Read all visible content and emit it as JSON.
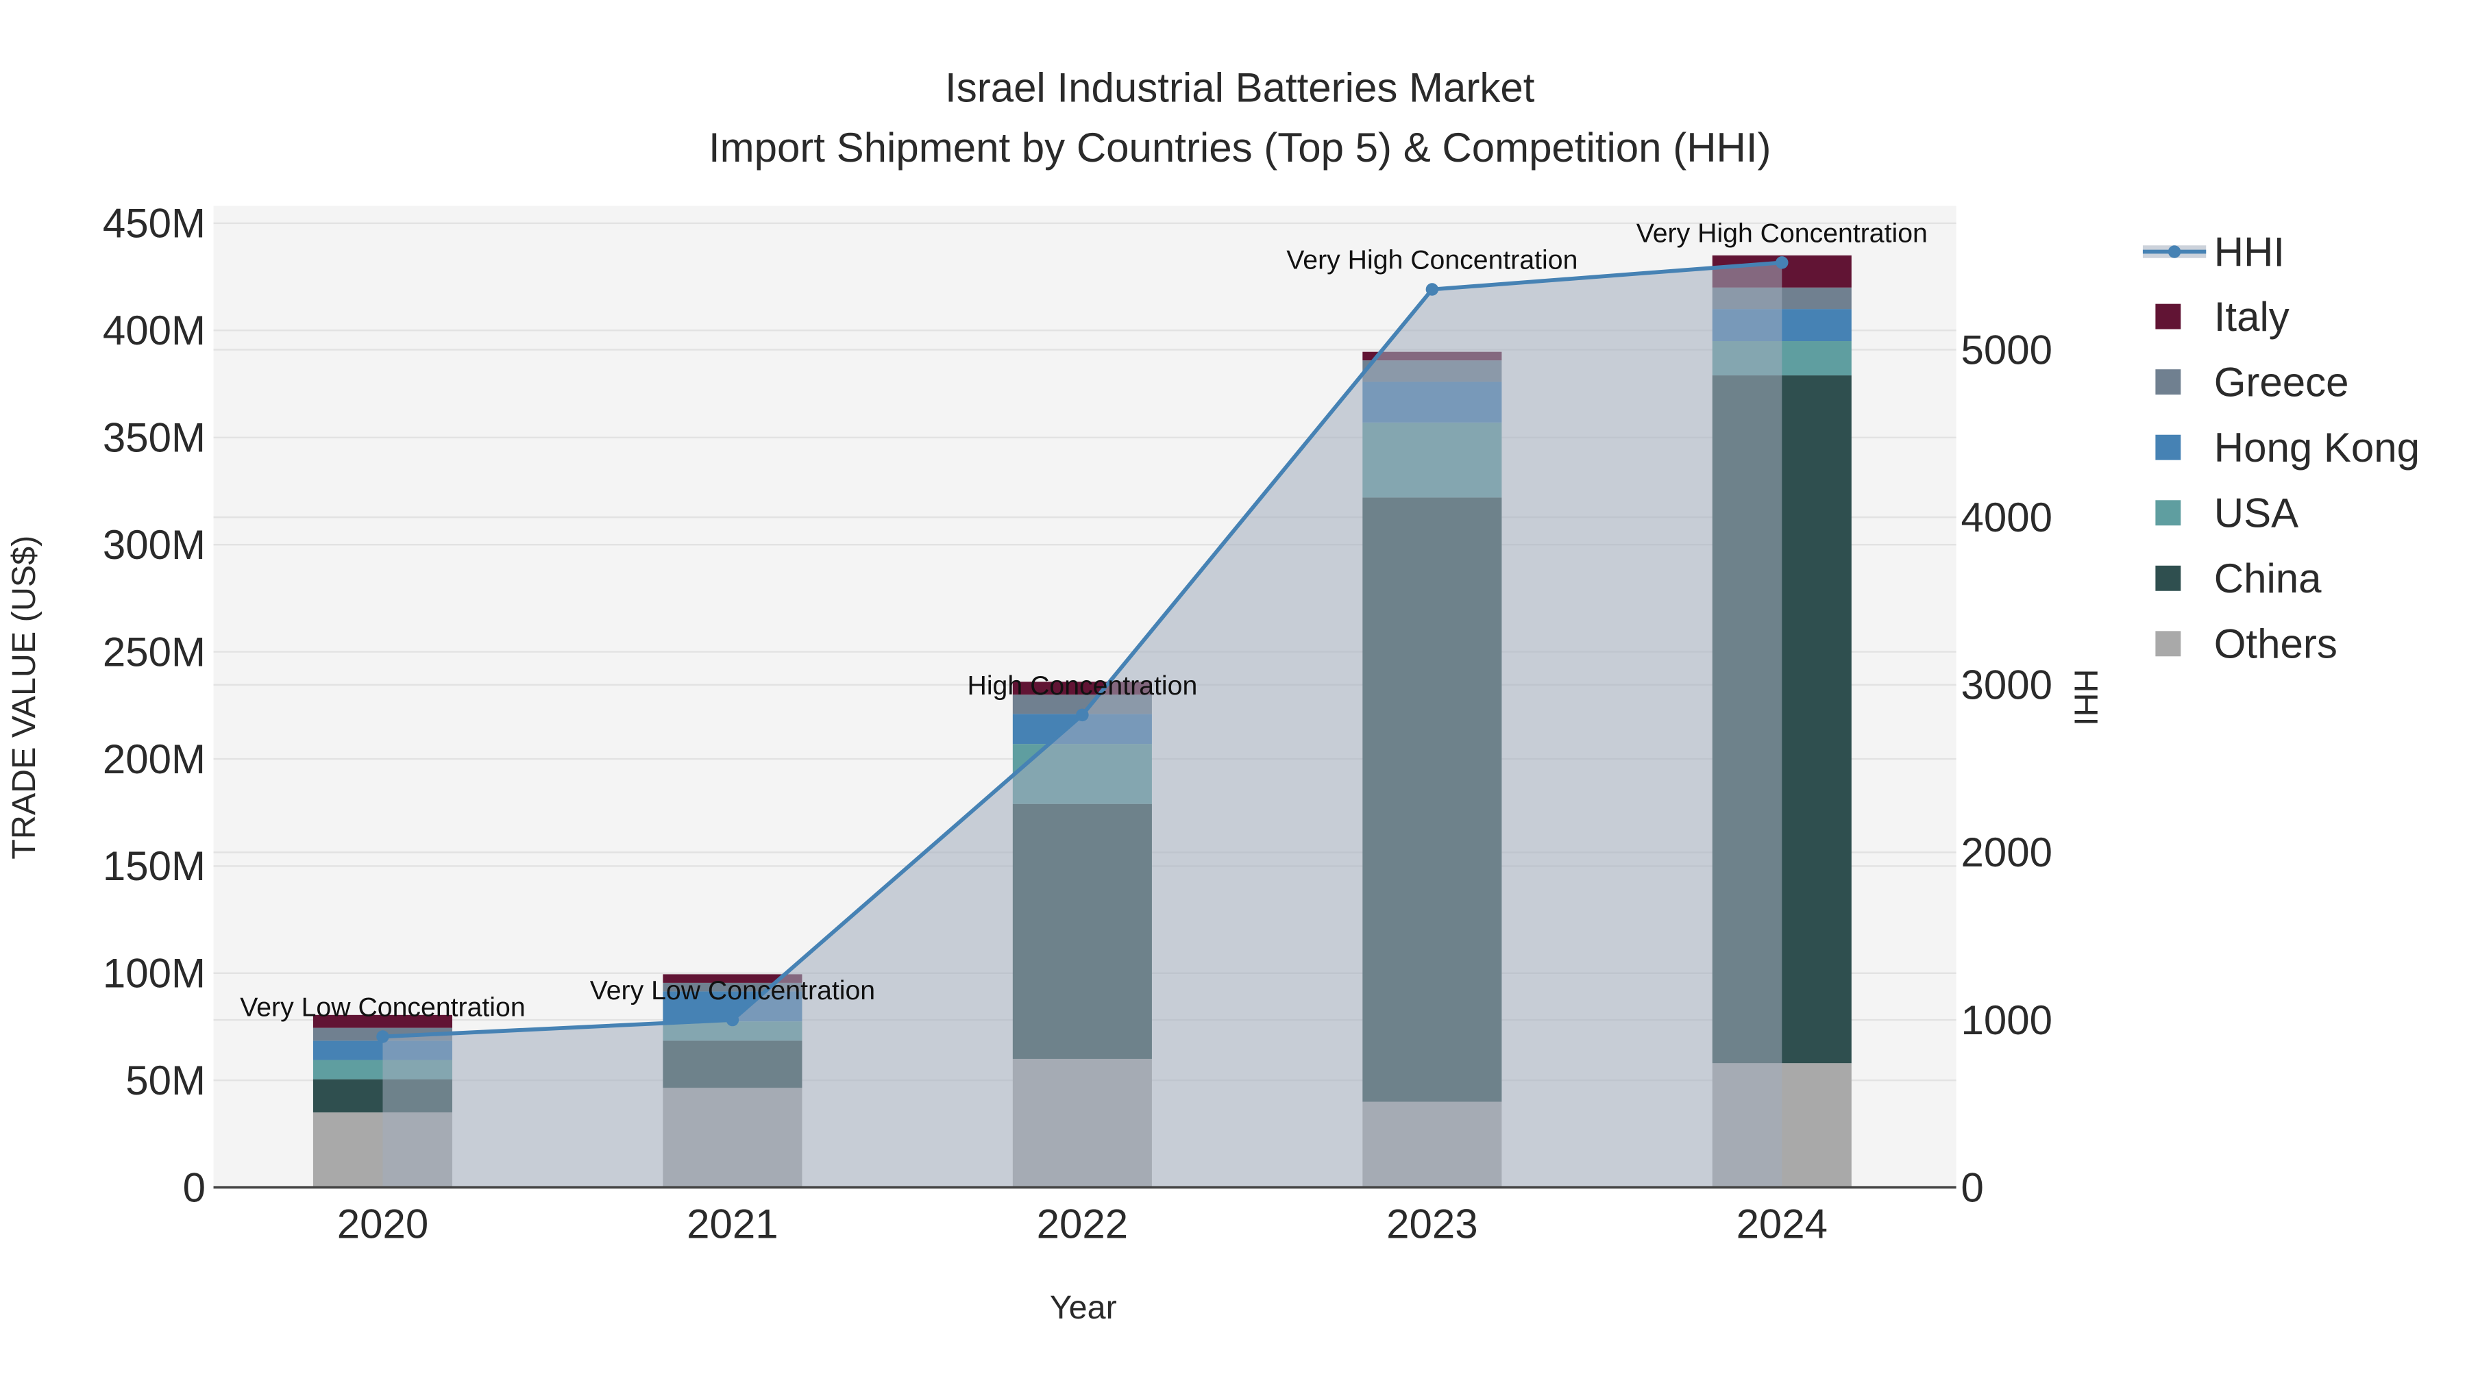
{
  "chart_data": {
    "type": "bar",
    "title": "Israel Industrial Batteries Market",
    "subtitle": "Import Shipment by Countries (Top 5) & Competition (HHI)",
    "xlabel": "Year",
    "ylabel": "TRADE VALUE (US$)",
    "y2label": "HHI",
    "categories": [
      "2020",
      "2021",
      "2022",
      "2023",
      "2024"
    ],
    "ylim": [
      0,
      450000000
    ],
    "y_ticks": [
      "0",
      "50M",
      "100M",
      "150M",
      "200M",
      "250M",
      "300M",
      "350M",
      "400M",
      "450M"
    ],
    "y2lim": [
      0,
      5800
    ],
    "y2_ticks": [
      "0",
      "1000",
      "2000",
      "3000",
      "4000",
      "5000"
    ],
    "stacked": true,
    "grid": true,
    "legend_position": "right",
    "series": [
      {
        "name": "Others",
        "color": "#a9a9a9",
        "values": [
          35000000,
          46500000,
          60000000,
          40000000,
          58000000
        ]
      },
      {
        "name": "China",
        "color": "#2f4f4f",
        "values": [
          15500000,
          22000000,
          119000000,
          282000000,
          321000000
        ]
      },
      {
        "name": "USA",
        "color": "#5f9ea0",
        "values": [
          9000000,
          9000000,
          28000000,
          35000000,
          16000000
        ]
      },
      {
        "name": "Hong Kong",
        "color": "#4682b4",
        "values": [
          9000000,
          14000000,
          14000000,
          19000000,
          15000000
        ]
      },
      {
        "name": "Greece",
        "color": "#708090",
        "values": [
          6000000,
          4000000,
          9000000,
          10000000,
          10000000
        ]
      },
      {
        "name": "Italy",
        "color": "#611434",
        "values": [
          6000000,
          4000000,
          6000000,
          4000000,
          15000000
        ]
      }
    ],
    "hhi": {
      "name": "HHI",
      "color": "#4682b4",
      "values": [
        900,
        1000,
        2820,
        5360,
        5520
      ],
      "labels": [
        "Very Low Concentration",
        "Very Low Concentration",
        "High Concentration",
        "Very High Concentration",
        "Very High Concentration"
      ]
    },
    "legend": [
      "HHI",
      "Italy",
      "Greece",
      "Hong Kong",
      "USA",
      "China",
      "Others"
    ]
  }
}
